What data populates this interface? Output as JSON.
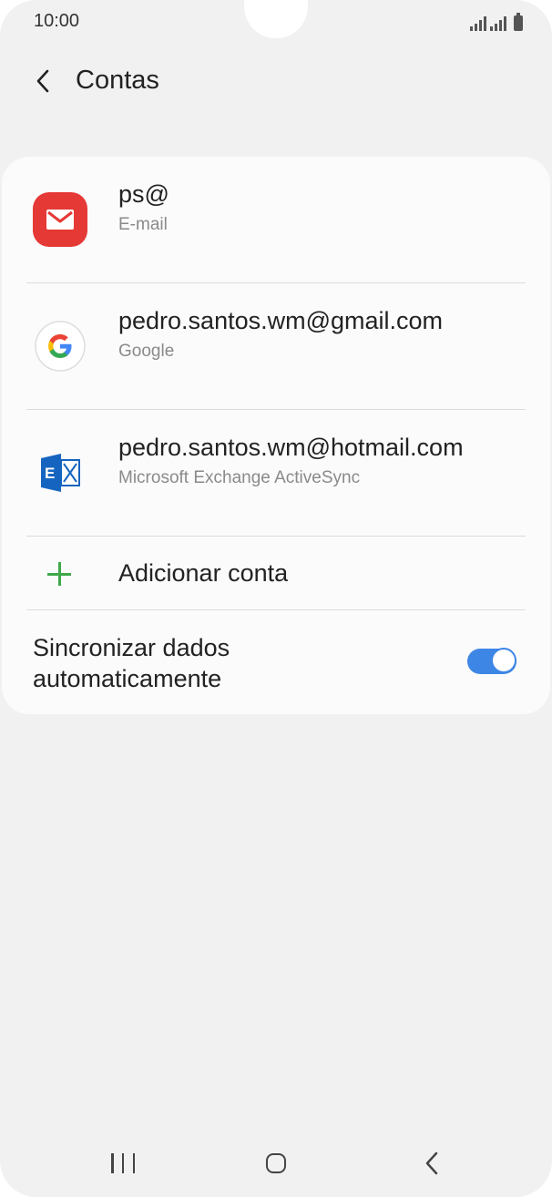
{
  "status_bar": {
    "time": "10:00",
    "icons": [
      "signal-icon",
      "signal-icon",
      "battery-icon"
    ]
  },
  "header": {
    "back_icon": "chevron-left-icon",
    "title": "Contas"
  },
  "accounts": [
    {
      "icon": "email-app-icon",
      "title": "ps@",
      "subtitle": "E-mail",
      "accent": "#e53935"
    },
    {
      "icon": "google-icon",
      "title": "pedro.santos.wm@gmail.com",
      "subtitle": "Google"
    },
    {
      "icon": "exchange-icon",
      "title": "pedro.santos.wm@hotmail.com",
      "subtitle": "Microsoft Exchange ActiveSync",
      "accent": "#1565c0"
    }
  ],
  "add_account": {
    "icon": "plus-icon",
    "label": "Adicionar conta",
    "accent": "#3fa84a"
  },
  "sync": {
    "label": "Sincronizar dados automaticamente",
    "enabled": true,
    "accent": "#3e86e6"
  },
  "nav_bar": {
    "recent_icon": "recent-apps-icon",
    "home_icon": "home-icon",
    "back_icon": "back-icon"
  }
}
